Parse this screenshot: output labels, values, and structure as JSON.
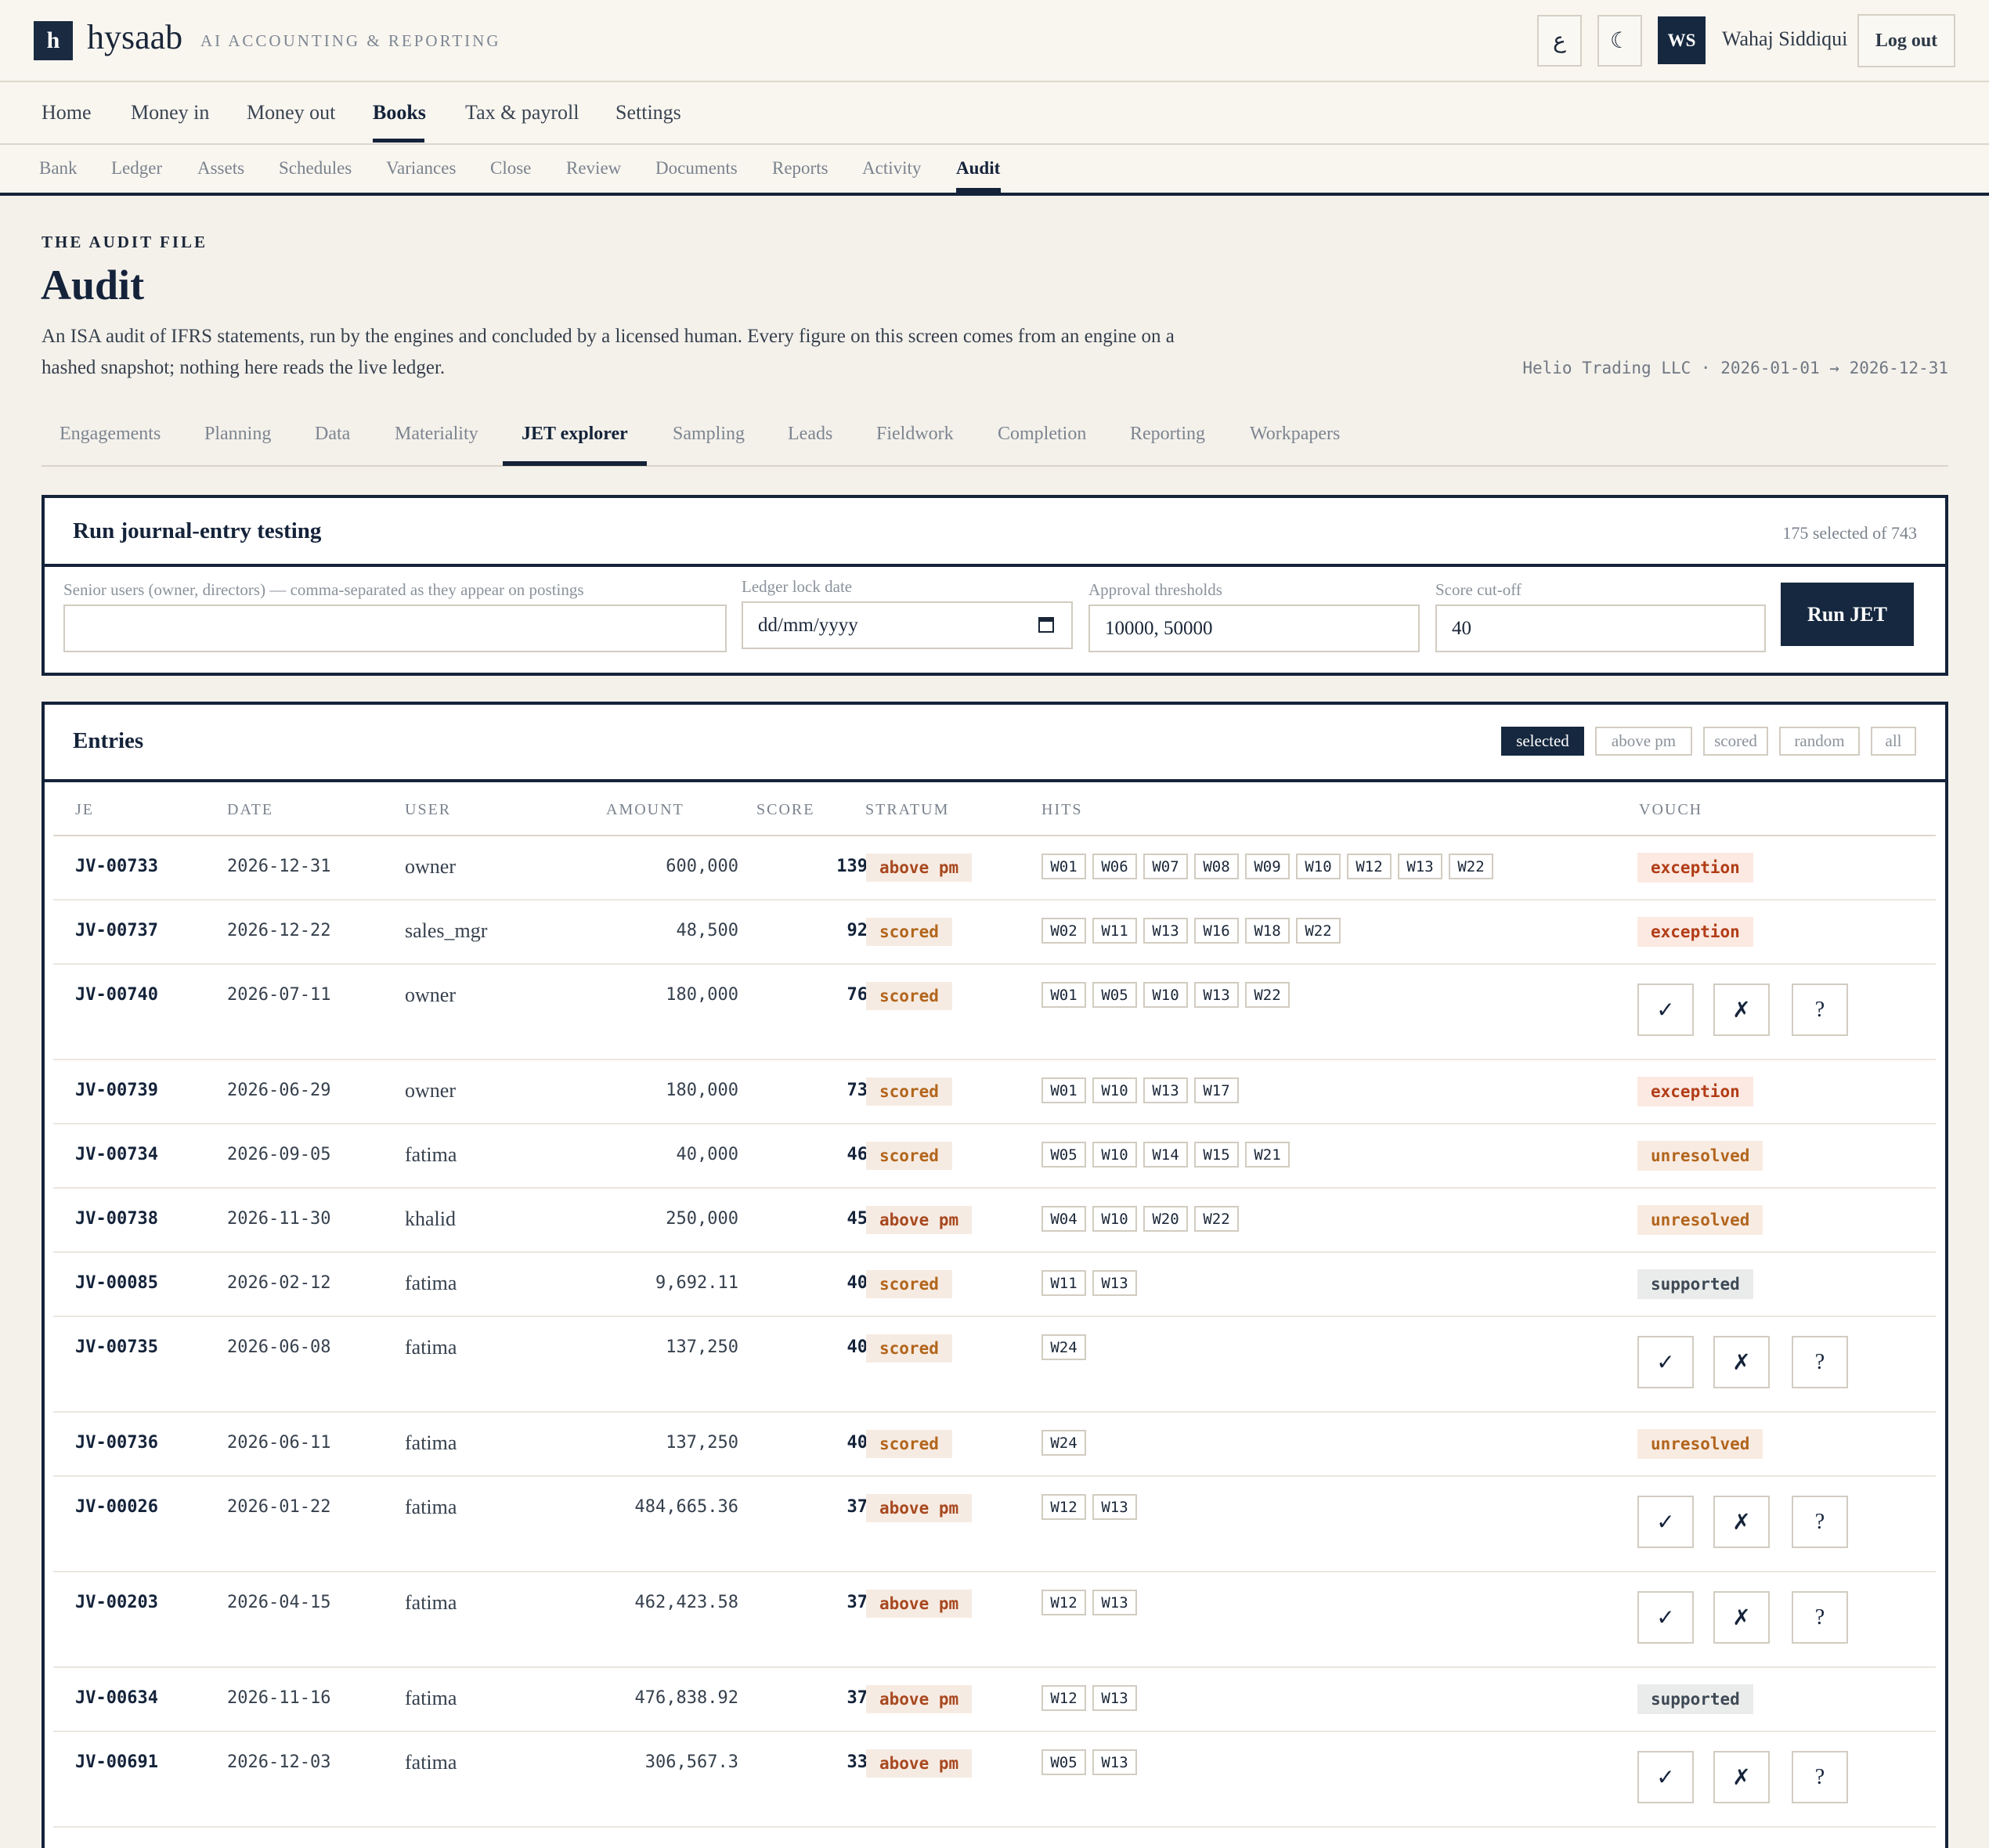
{
  "app": {
    "logo_letter": "h",
    "brand": "hysaab",
    "tagline": "AI ACCOUNTING & REPORTING",
    "lang_glyph": "ع",
    "theme_glyph": "☾",
    "user_initials": "WS",
    "user_name": "Wahaj Siddiqui",
    "logout_label": "Log out"
  },
  "nav": {
    "primary": [
      "Home",
      "Money in",
      "Money out",
      "Books",
      "Tax & payroll",
      "Settings"
    ],
    "primary_active": "Books",
    "secondary": [
      "Bank",
      "Ledger",
      "Assets",
      "Schedules",
      "Variances",
      "Close",
      "Review",
      "Documents",
      "Reports",
      "Activity",
      "Audit"
    ],
    "secondary_active": "Audit"
  },
  "header": {
    "kicker": "THE AUDIT FILE",
    "title": "Audit",
    "description": "An ISA audit of IFRS statements, run by the engines and concluded by a licensed human. Every figure on this screen comes from an engine on a hashed snapshot; nothing here reads the live ledger.",
    "entity": "Helio Trading LLC · 2026-01-01 → 2026-12-31"
  },
  "audit_tabs": {
    "items": [
      "Engagements",
      "Planning",
      "Data",
      "Materiality",
      "JET explorer",
      "Sampling",
      "Leads",
      "Fieldwork",
      "Completion",
      "Reporting",
      "Workpapers"
    ],
    "active": "JET explorer"
  },
  "run_panel": {
    "title": "Run journal-entry testing",
    "meta": "175 selected of 743",
    "senior_users_label": "Senior users (owner, directors) — comma-separated as they appear on postings",
    "senior_users_value": "",
    "lock_date_label": "Ledger lock date",
    "lock_date_value": "dd/mm/yyyy",
    "thresholds_label": "Approval thresholds",
    "thresholds_value": "10000, 50000",
    "cutoff_label": "Score cut-off",
    "cutoff_value": "40",
    "run_label": "Run JET"
  },
  "entries": {
    "title": "Entries",
    "filters": [
      "selected",
      "above pm",
      "scored",
      "random",
      "all"
    ],
    "filter_active": "selected",
    "columns": [
      "JE",
      "DATE",
      "USER",
      "AMOUNT",
      "SCORE",
      "STRATUM",
      "HITS",
      "VOUCH"
    ],
    "vouch_glyphs": [
      "✓",
      "✗",
      "?"
    ],
    "rows": [
      {
        "je": "JV-00733",
        "date": "2026-12-31",
        "user": "owner",
        "amount": "600,000",
        "score": "139",
        "stratum": "above pm",
        "hits": [
          "W01",
          "W06",
          "W07",
          "W08",
          "W09",
          "W10",
          "W12",
          "W13",
          "W22"
        ],
        "vouch": "exception"
      },
      {
        "je": "JV-00737",
        "date": "2026-12-22",
        "user": "sales_mgr",
        "amount": "48,500",
        "score": "92",
        "stratum": "scored",
        "hits": [
          "W02",
          "W11",
          "W13",
          "W16",
          "W18",
          "W22"
        ],
        "vouch": "exception"
      },
      {
        "je": "JV-00740",
        "date": "2026-07-11",
        "user": "owner",
        "amount": "180,000",
        "score": "76",
        "stratum": "scored",
        "hits": [
          "W01",
          "W05",
          "W10",
          "W13",
          "W22"
        ],
        "vouch": ""
      },
      {
        "je": "JV-00739",
        "date": "2026-06-29",
        "user": "owner",
        "amount": "180,000",
        "score": "73",
        "stratum": "scored",
        "hits": [
          "W01",
          "W10",
          "W13",
          "W17"
        ],
        "vouch": "exception"
      },
      {
        "je": "JV-00734",
        "date": "2026-09-05",
        "user": "fatima",
        "amount": "40,000",
        "score": "46",
        "stratum": "scored",
        "hits": [
          "W05",
          "W10",
          "W14",
          "W15",
          "W21"
        ],
        "vouch": "unresolved"
      },
      {
        "je": "JV-00738",
        "date": "2026-11-30",
        "user": "khalid",
        "amount": "250,000",
        "score": "45",
        "stratum": "above pm",
        "hits": [
          "W04",
          "W10",
          "W20",
          "W22"
        ],
        "vouch": "unresolved"
      },
      {
        "je": "JV-00085",
        "date": "2026-02-12",
        "user": "fatima",
        "amount": "9,692.11",
        "score": "40",
        "stratum": "scored",
        "hits": [
          "W11",
          "W13"
        ],
        "vouch": "supported"
      },
      {
        "je": "JV-00735",
        "date": "2026-06-08",
        "user": "fatima",
        "amount": "137,250",
        "score": "40",
        "stratum": "scored",
        "hits": [
          "W24"
        ],
        "vouch": ""
      },
      {
        "je": "JV-00736",
        "date": "2026-06-11",
        "user": "fatima",
        "amount": "137,250",
        "score": "40",
        "stratum": "scored",
        "hits": [
          "W24"
        ],
        "vouch": "unresolved"
      },
      {
        "je": "JV-00026",
        "date": "2026-01-22",
        "user": "fatima",
        "amount": "484,665.36",
        "score": "37",
        "stratum": "above pm",
        "hits": [
          "W12",
          "W13"
        ],
        "vouch": ""
      },
      {
        "je": "JV-00203",
        "date": "2026-04-15",
        "user": "fatima",
        "amount": "462,423.58",
        "score": "37",
        "stratum": "above pm",
        "hits": [
          "W12",
          "W13"
        ],
        "vouch": ""
      },
      {
        "je": "JV-00634",
        "date": "2026-11-16",
        "user": "fatima",
        "amount": "476,838.92",
        "score": "37",
        "stratum": "above pm",
        "hits": [
          "W12",
          "W13"
        ],
        "vouch": "supported"
      },
      {
        "je": "JV-00691",
        "date": "2026-12-03",
        "user": "fatima",
        "amount": "306,567.3",
        "score": "33",
        "stratum": "above pm",
        "hits": [
          "W05",
          "W13"
        ],
        "vouch": ""
      }
    ]
  }
}
